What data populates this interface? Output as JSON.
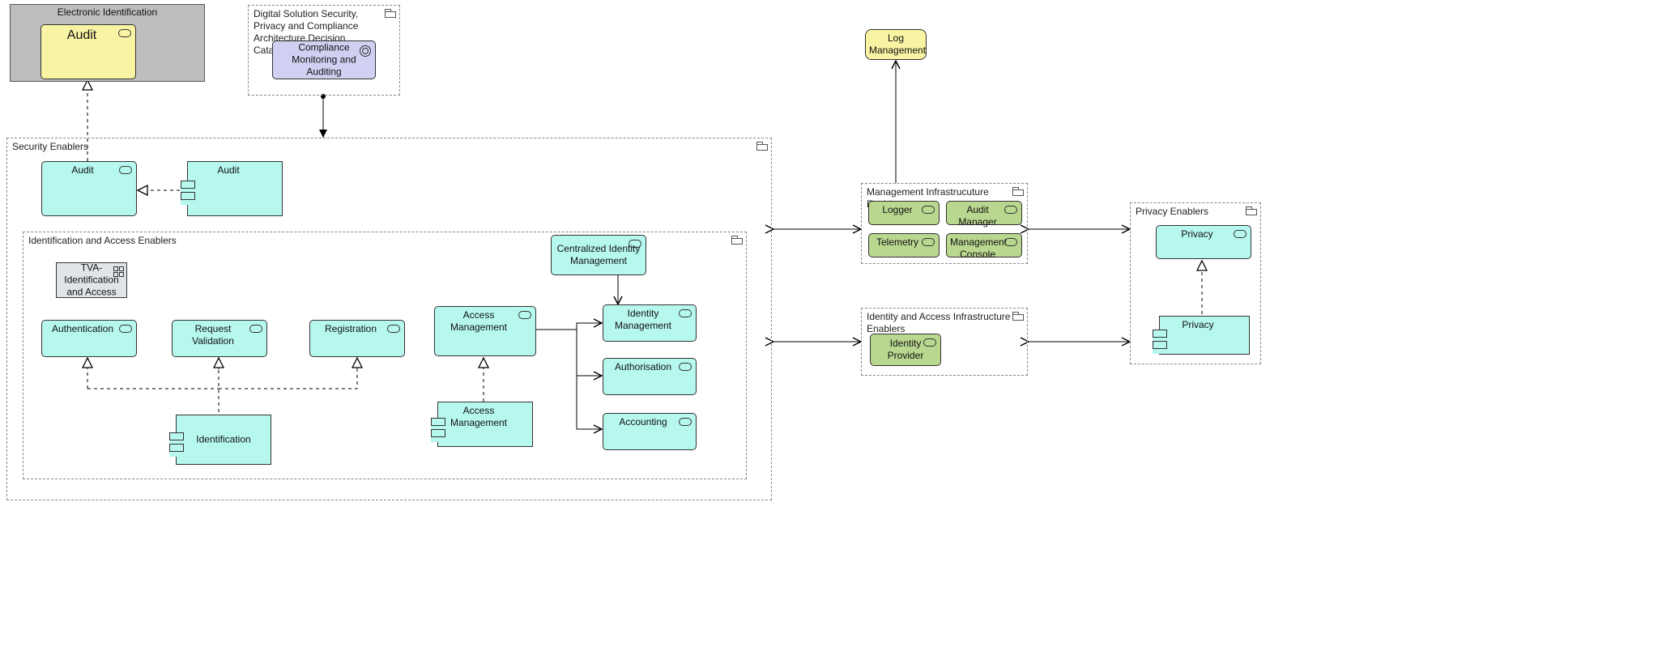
{
  "groups": {
    "electronicIdentification": {
      "title": "Electronic Identification"
    },
    "adCatalogue": {
      "title": "Digital Solution Security, Privacy and Compliance Architecture Decision Catalogue"
    },
    "securityEnablers": {
      "title": "Security Enablers"
    },
    "idAccessEnablers": {
      "title": "Identification and Access Enablers"
    },
    "logMgmt": {
      "title": "Log Management"
    },
    "mgmtInfraEnablers": {
      "title": "Management Infrastrucuture Enablers"
    },
    "idAccessInfraEnablers": {
      "title": "Identity and Access Infrastructure Enablers"
    },
    "privacyEnablers": {
      "title": "Privacy Enablers"
    }
  },
  "nodes": {
    "auditYellow": {
      "label": "Audit"
    },
    "compMonAudit": {
      "label": "Compliance Monitoring and Auditing"
    },
    "tva": {
      "label": "TVA-\nIdentification and Access"
    },
    "secAuditService": {
      "label": "Audit"
    },
    "secAuditComp": {
      "label": "Audit"
    },
    "authentication": {
      "label": "Authentication"
    },
    "requestValidation": {
      "label": "Request Validation"
    },
    "registration": {
      "label": "Registration"
    },
    "identificationComp": {
      "label": "Identification"
    },
    "accessManagement": {
      "label": "Access Management"
    },
    "accessManagementComp": {
      "label": "Access Management"
    },
    "centralizedIdentity": {
      "label": "Centralized Identity Management"
    },
    "identityManagement": {
      "label": "Identity Management"
    },
    "authorisation": {
      "label": "Authorisation"
    },
    "accounting": {
      "label": "Accounting"
    },
    "logger": {
      "label": "Logger"
    },
    "auditManager": {
      "label": "Audit Manager"
    },
    "telemetry": {
      "label": "Telemetry"
    },
    "mgmtConsole": {
      "label": "Management Console"
    },
    "identityProvider": {
      "label": "Identity Provider"
    },
    "privacyService": {
      "label": "Privacy"
    },
    "privacyComp": {
      "label": "Privacy"
    }
  }
}
